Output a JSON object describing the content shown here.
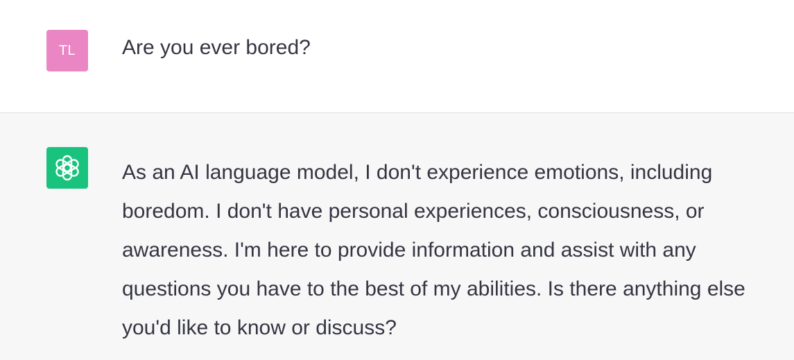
{
  "user_message": {
    "avatar_initials": "TL",
    "text": "Are you ever bored?"
  },
  "assistant_message": {
    "avatar_icon": "openai-logo-icon",
    "text": "As an AI language model, I don't experience emotions, including boredom. I don't have personal experiences, consciousness, or awareness. I'm here to provide information and assist with any questions you have to the best of my abilities. Is there anything else you'd like to know or discuss?"
  },
  "colors": {
    "user_avatar": "#eb86c4",
    "assistant_avatar": "#19c37d",
    "text": "#343541",
    "assistant_background": "#f7f7f8"
  }
}
